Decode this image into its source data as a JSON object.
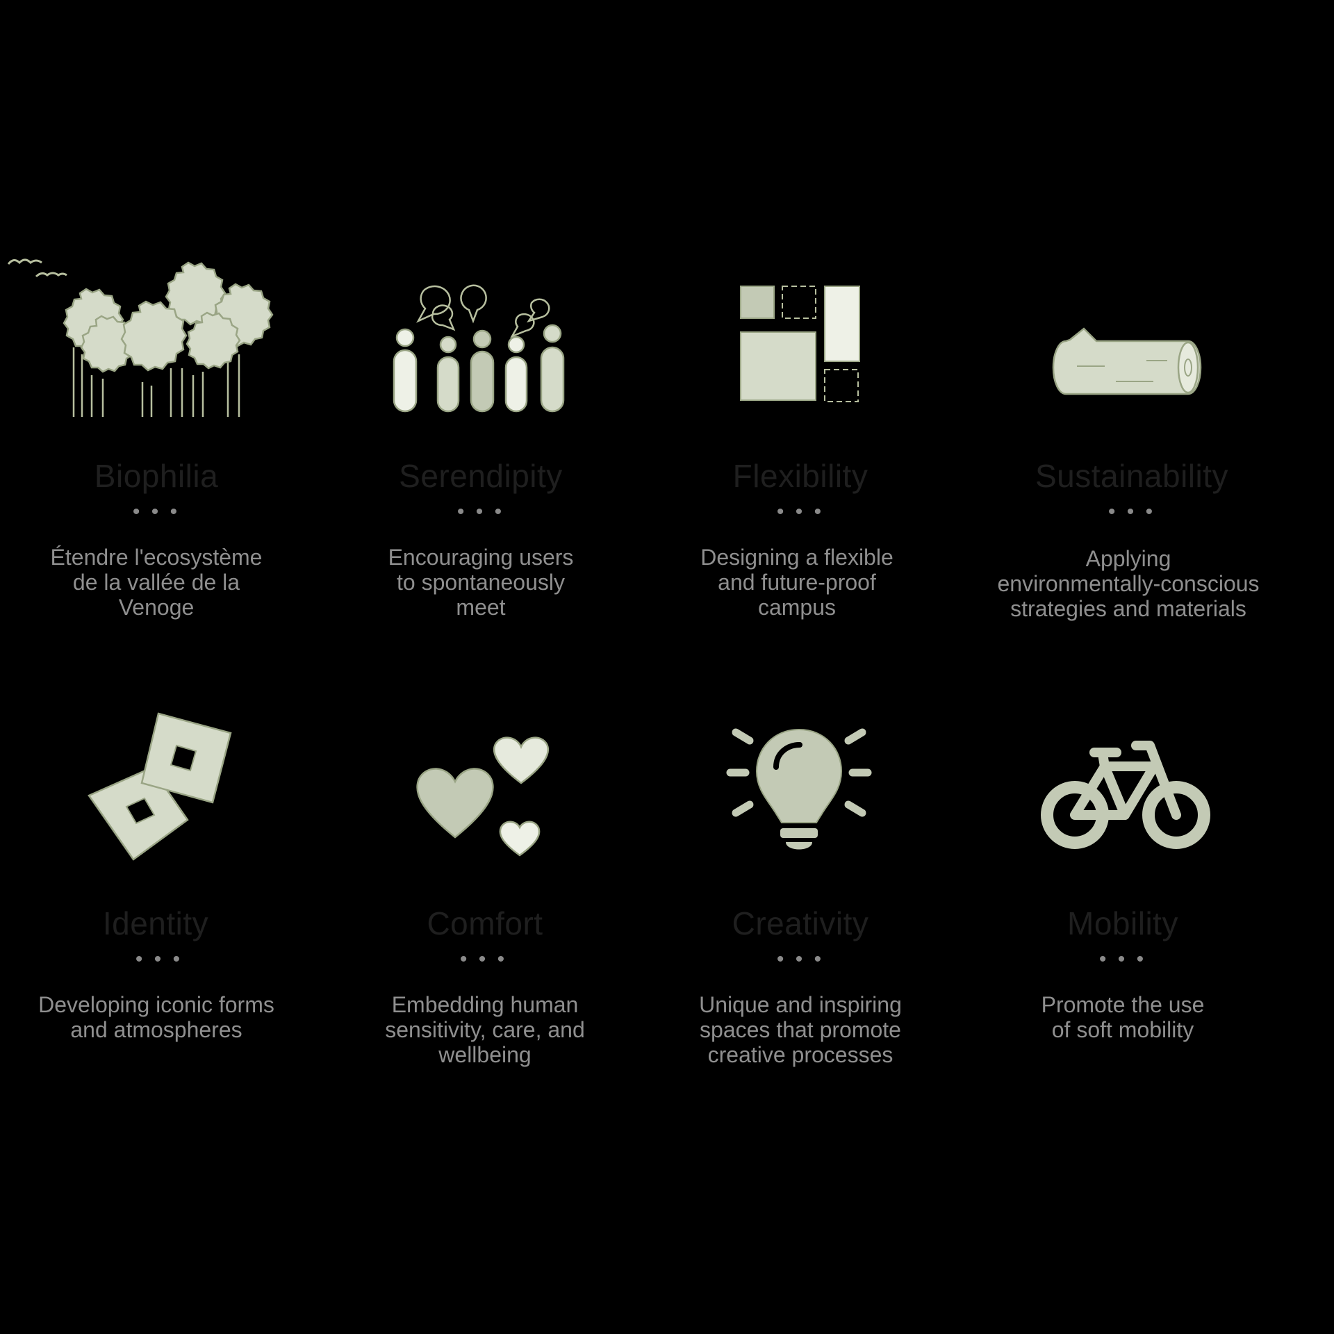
{
  "colors": {
    "background": "#000000",
    "icon_fill": "#d5dbc9",
    "icon_fill_dark": "#c3cab5",
    "icon_fill_light": "#eef1e7",
    "icon_stroke": "#9aa585",
    "title": "#1f1f1f",
    "description": "#8f8f8f"
  },
  "separator": "• • •",
  "principles": [
    {
      "title": "Biophilia",
      "icon": "trees-icon",
      "description": [
        "Étendre l'ecosystème",
        "de la vallée de la",
        "Venoge"
      ]
    },
    {
      "title": "Serendipity",
      "icon": "people-speech-icon",
      "description": [
        "Encouraging users",
        "to spontaneously",
        "meet"
      ]
    },
    {
      "title": "Flexibility",
      "icon": "modular-blocks-icon",
      "description": [
        "Designing a flexible",
        "and future-proof",
        "campus"
      ]
    },
    {
      "title": "Sustainability",
      "icon": "log-icon",
      "description": [
        "Applying",
        "environmentally-conscious",
        "strategies and materials"
      ]
    },
    {
      "title": "Identity",
      "icon": "tilted-squares-icon",
      "description": [
        "Developing iconic forms",
        "and atmospheres"
      ]
    },
    {
      "title": "Comfort",
      "icon": "hearts-icon",
      "description": [
        "Embedding human",
        "sensitivity, care, and",
        "wellbeing"
      ]
    },
    {
      "title": "Creativity",
      "icon": "lightbulb-icon",
      "description": [
        "Unique and inspiring",
        "spaces that promote",
        "creative processes"
      ]
    },
    {
      "title": "Mobility",
      "icon": "bicycle-icon",
      "description": [
        "Promote the use",
        "of soft mobility"
      ]
    }
  ]
}
